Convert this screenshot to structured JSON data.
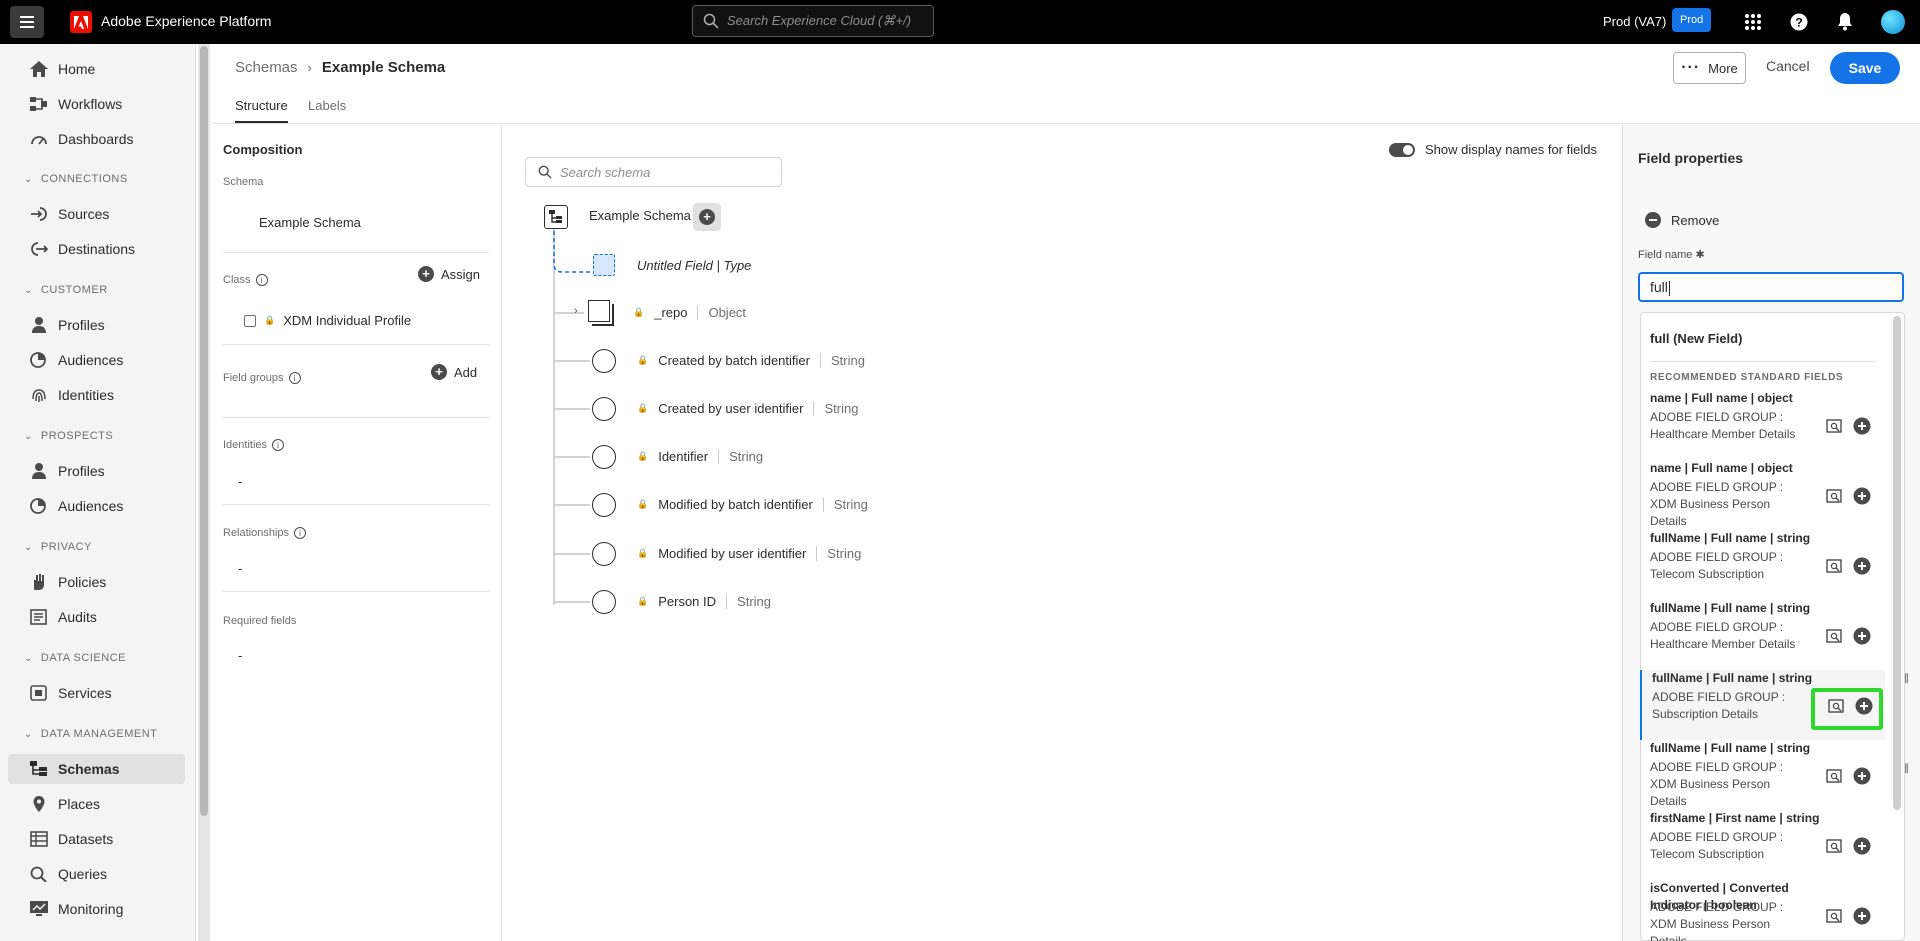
{
  "topbar": {
    "app_title": "Adobe Experience Platform",
    "search_placeholder": "Search Experience Cloud (⌘+/)",
    "org": "Prod (VA7)",
    "env_badge": "Prod"
  },
  "sidebar": {
    "items": [
      {
        "label": "Home",
        "icon": "home-icon"
      },
      {
        "label": "Workflows",
        "icon": "workflow-icon"
      },
      {
        "label": "Dashboards",
        "icon": "dashboard-icon"
      },
      {
        "label": "Sources",
        "icon": "source-icon"
      },
      {
        "label": "Destinations",
        "icon": "destination-icon"
      },
      {
        "label": "Profiles",
        "icon": "person-icon"
      },
      {
        "label": "Audiences",
        "icon": "audience-icon"
      },
      {
        "label": "Identities",
        "icon": "fingerprint-icon"
      },
      {
        "label": "Profiles",
        "icon": "person-icon"
      },
      {
        "label": "Audiences",
        "icon": "audience-icon"
      },
      {
        "label": "Policies",
        "icon": "hand-icon"
      },
      {
        "label": "Audits",
        "icon": "audit-icon"
      },
      {
        "label": "Services",
        "icon": "services-icon"
      },
      {
        "label": "Schemas",
        "icon": "schema-icon"
      },
      {
        "label": "Places",
        "icon": "pin-icon"
      },
      {
        "label": "Datasets",
        "icon": "dataset-icon"
      },
      {
        "label": "Queries",
        "icon": "query-icon"
      },
      {
        "label": "Monitoring",
        "icon": "monitor-icon"
      }
    ],
    "sections": [
      "CONNECTIONS",
      "CUSTOMER",
      "PROSPECTS",
      "PRIVACY",
      "DATA SCIENCE",
      "DATA MANAGEMENT"
    ],
    "active": "Schemas"
  },
  "header": {
    "breadcrumb_parent": "Schemas",
    "breadcrumb_current": "Example Schema",
    "tabs": [
      "Structure",
      "Labels"
    ],
    "more_label": "More",
    "cancel_label": "Cancel",
    "save_label": "Save"
  },
  "composition": {
    "title": "Composition",
    "schema_label": "Schema",
    "schema_value": "Example Schema",
    "class_label": "Class",
    "assign_label": "Assign",
    "class_value": "XDM Individual Profile",
    "fieldgroups_label": "Field groups",
    "add_label": "Add",
    "identities_label": "Identities",
    "identities_value": "-",
    "relationships_label": "Relationships",
    "relationships_value": "-",
    "required_label": "Required fields",
    "required_value": "-"
  },
  "canvas": {
    "search_placeholder": "Search schema",
    "toggle_label": "Show display names for fields",
    "root_name": "Example Schema",
    "new_field": "Untitled Field | Type",
    "fields": [
      {
        "name": "_repo",
        "type": "Object"
      },
      {
        "name": "Created by batch identifier",
        "type": "String"
      },
      {
        "name": "Created by user identifier",
        "type": "String"
      },
      {
        "name": "Identifier",
        "type": "String"
      },
      {
        "name": "Modified by batch identifier",
        "type": "String"
      },
      {
        "name": "Modified by user identifier",
        "type": "String"
      },
      {
        "name": "Person ID",
        "type": "String"
      }
    ]
  },
  "field_properties": {
    "title": "Field properties",
    "remove_label": "Remove",
    "field_name_label": "Field name",
    "field_name_value": "full",
    "new_field_option": "full (New Field)",
    "recommended_header": "RECOMMENDED STANDARD FIELDS",
    "options": [
      {
        "title": "name | Full name | object",
        "desc": "ADOBE FIELD GROUP : Healthcare Member Details"
      },
      {
        "title": "name | Full name | object",
        "desc": "ADOBE FIELD GROUP : XDM Business Person Details"
      },
      {
        "title": "fullName | Full name | string",
        "desc": "ADOBE FIELD GROUP : Telecom Subscription"
      },
      {
        "title": "fullName | Full name | string",
        "desc": "ADOBE FIELD GROUP : Healthcare Member Details"
      },
      {
        "title": "fullName | Full name | string",
        "desc": "ADOBE FIELD GROUP : Subscription Details"
      },
      {
        "title": "fullName | Full name | string",
        "desc": "ADOBE FIELD GROUP : XDM Business Person Details"
      },
      {
        "title": "firstName | First name | string",
        "desc": "ADOBE FIELD GROUP : Telecom Subscription"
      },
      {
        "title": "isConverted | Converted Indicator | boolean",
        "desc": "ADOBE FIELD GROUP : XDM Business Person Details"
      }
    ]
  },
  "colors": {
    "accent": "#1473e6",
    "highlight": "#2fd82f",
    "topbar": "#000000"
  }
}
